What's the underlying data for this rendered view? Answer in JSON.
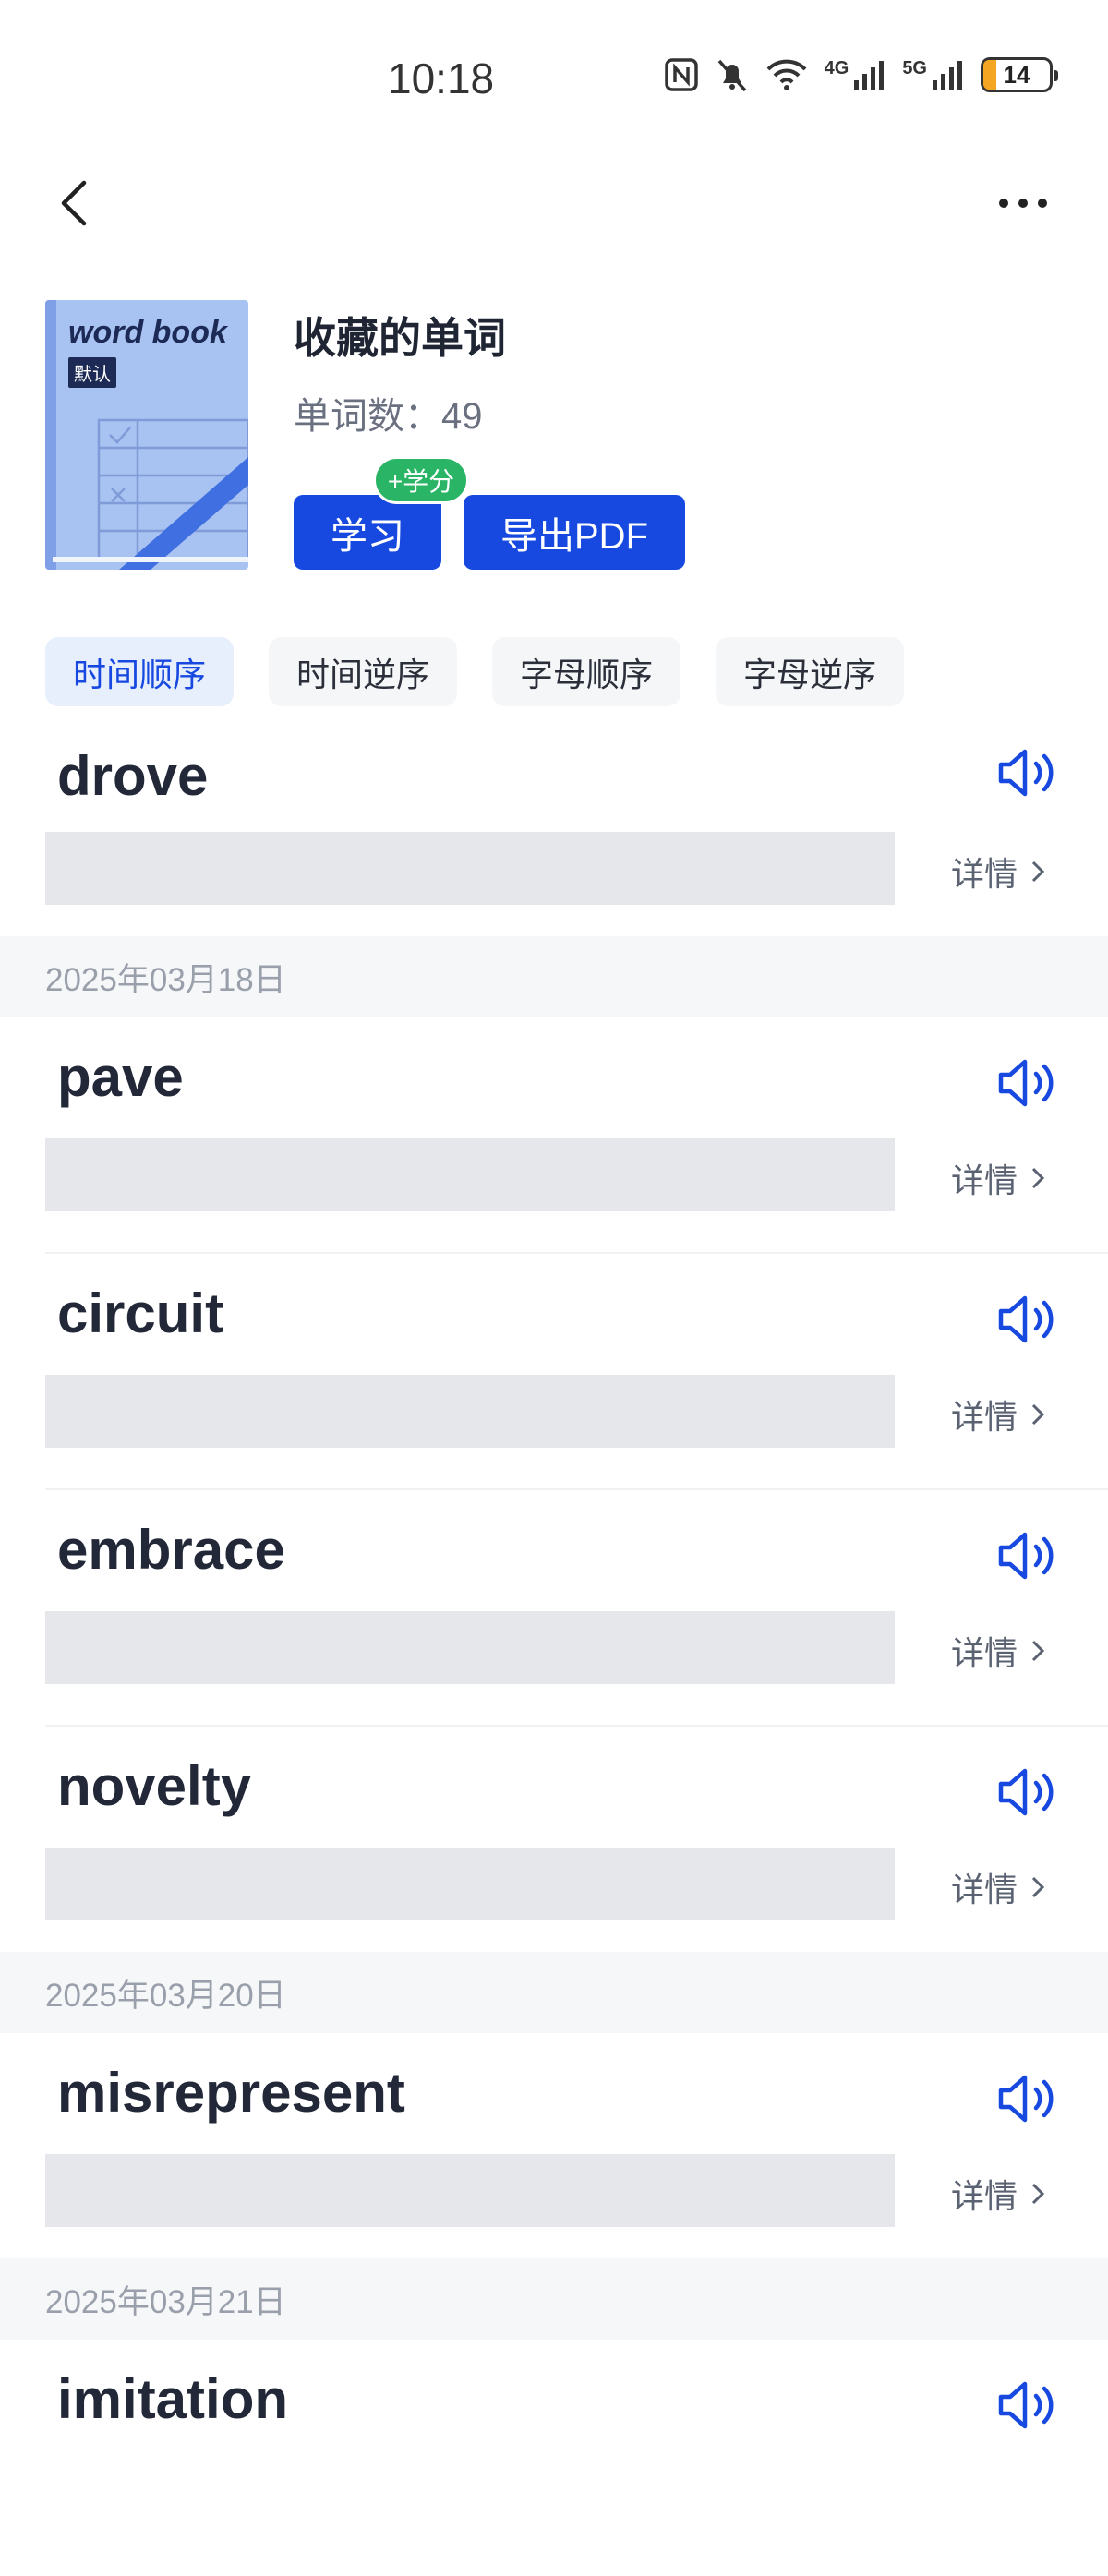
{
  "status": {
    "time": "10:18",
    "battery": "14",
    "net1": "4G",
    "net2": "5G"
  },
  "book": {
    "cover_title": "word book",
    "cover_badge": "默认",
    "title": "收藏的单词",
    "count_text": "单词数：49",
    "study_label": "学习",
    "credit_badge": "+学分",
    "export_label": "导出PDF"
  },
  "sort_tabs": [
    {
      "label": "时间顺序",
      "active": true
    },
    {
      "label": "时间逆序",
      "active": false
    },
    {
      "label": "字母顺序",
      "active": false
    },
    {
      "label": "字母逆序",
      "active": false
    }
  ],
  "detail_label": "详情",
  "sections": [
    {
      "date": "",
      "words": [
        "drove"
      ]
    },
    {
      "date": "2025年03月18日",
      "words": [
        "pave",
        "circuit",
        "embrace",
        "novelty"
      ]
    },
    {
      "date": "2025年03月20日",
      "words": [
        "misrepresent"
      ]
    },
    {
      "date": "2025年03月21日",
      "words": [
        "imitation"
      ]
    }
  ],
  "colors": {
    "accent": "#1749e0",
    "credit": "#29b565",
    "placeholder": "#e5e7eb"
  }
}
